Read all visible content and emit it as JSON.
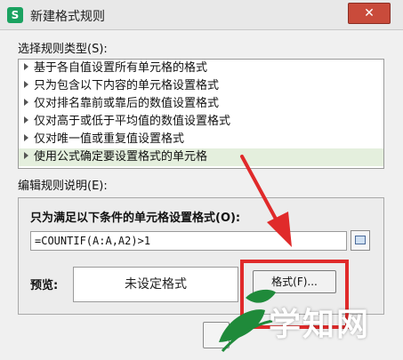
{
  "window": {
    "app_icon": "S",
    "title": "新建格式规则",
    "close_label": "✕"
  },
  "rule_type": {
    "label": "选择规则类型(S):",
    "items": [
      "基于各自值设置所有单元格的格式",
      "只为包含以下内容的单元格设置格式",
      "仅对排名靠前或靠后的数值设置格式",
      "仅对高于或低于平均值的数值设置格式",
      "仅对唯一值或重复值设置格式",
      "使用公式确定要设置格式的单元格"
    ],
    "selected_index": 5
  },
  "rule_desc": {
    "label": "编辑规则说明(E):",
    "formula_label": "只为满足以下条件的单元格设置格式(O):",
    "formula_value": "=COUNTIF(A:A,A2)>1",
    "preview_label": "预览:",
    "preview_text": "未设定格式",
    "format_button": "格式(F)..."
  },
  "watermark": {
    "text": "学知网"
  },
  "colors": {
    "selection": "#e4efdd",
    "annotation_red": "#e02a2a",
    "watermark_green": "#1f8a3a"
  }
}
